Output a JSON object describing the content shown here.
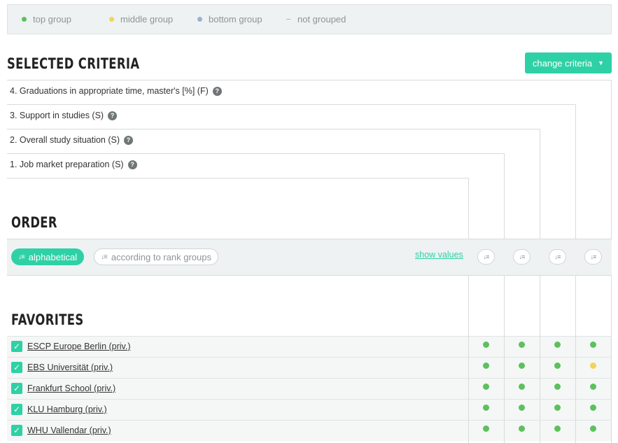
{
  "legend": {
    "items": [
      {
        "label": "top group",
        "color": "#5cc15c",
        "kind": "dot"
      },
      {
        "label": "middle group",
        "color": "#f2d45a",
        "kind": "dot"
      },
      {
        "label": "bottom group",
        "color": "#9db0d0",
        "kind": "dot"
      },
      {
        "label": "not grouped",
        "color": "#b0b6b6",
        "kind": "dash"
      }
    ]
  },
  "selected_criteria": {
    "title": "SELECTED CRITERIA",
    "change_button": "change criteria",
    "criteria": [
      "4. Graduations in appropriate time, master's [%] (F)",
      "3. Support in studies (S)",
      "2. Overall study situation (S)",
      "1. Job market preparation (S)"
    ]
  },
  "order": {
    "title": "ORDER",
    "alphabetical": "alphabetical",
    "rank_groups": "according to rank groups",
    "show_values": "show values"
  },
  "favorites": {
    "title": "FAVORITES",
    "rows": [
      {
        "name": "ESCP Europe Berlin (priv.)",
        "groups": [
          "top",
          "top",
          "top",
          "top"
        ]
      },
      {
        "name": "EBS Universität (priv.)",
        "groups": [
          "top",
          "top",
          "top",
          "middle"
        ]
      },
      {
        "name": "Frankfurt School (priv.)",
        "groups": [
          "top",
          "top",
          "top",
          "top"
        ]
      },
      {
        "name": "KLU Hamburg (priv.)",
        "groups": [
          "top",
          "top",
          "top",
          "top"
        ]
      },
      {
        "name": "WHU Vallendar (priv.)",
        "groups": [
          "top",
          "top",
          "top",
          "top"
        ]
      }
    ]
  },
  "colors": {
    "accent": "#2ed1a5",
    "top": "#5cc15c",
    "middle": "#f2d45a",
    "bottom": "#9db0d0"
  },
  "icons": {
    "help": "question-circle-icon",
    "sort": "sort-icon",
    "check": "checkmark-icon",
    "dropdown": "caret-down-icon"
  }
}
